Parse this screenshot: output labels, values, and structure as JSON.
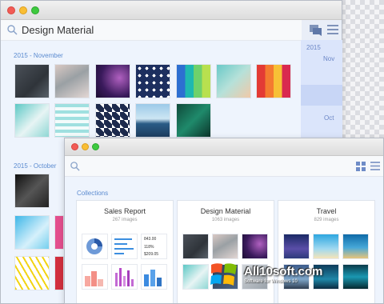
{
  "window_back": {
    "search_title": "Design Material",
    "months": [
      "2015 - November",
      "2015 - October"
    ],
    "timeline": {
      "year": "2015",
      "nov": "Nov",
      "oct": "Oct"
    }
  },
  "window_front": {
    "collections_title": "Collections",
    "cards": [
      {
        "name": "Sales Report",
        "count": "267 images"
      },
      {
        "name": "Design Material",
        "count": "1063 images"
      },
      {
        "name": "Travel",
        "count": "829 images"
      }
    ],
    "stats": [
      "843.00",
      "118%",
      "$209.05"
    ]
  },
  "watermark": {
    "title": "All10soft.com",
    "subtitle": "Software for Windows 10"
  },
  "colors": {
    "accent": "#5b8bd0",
    "timeline": "#dbe5fb",
    "content_bg": "#eef4fd"
  }
}
